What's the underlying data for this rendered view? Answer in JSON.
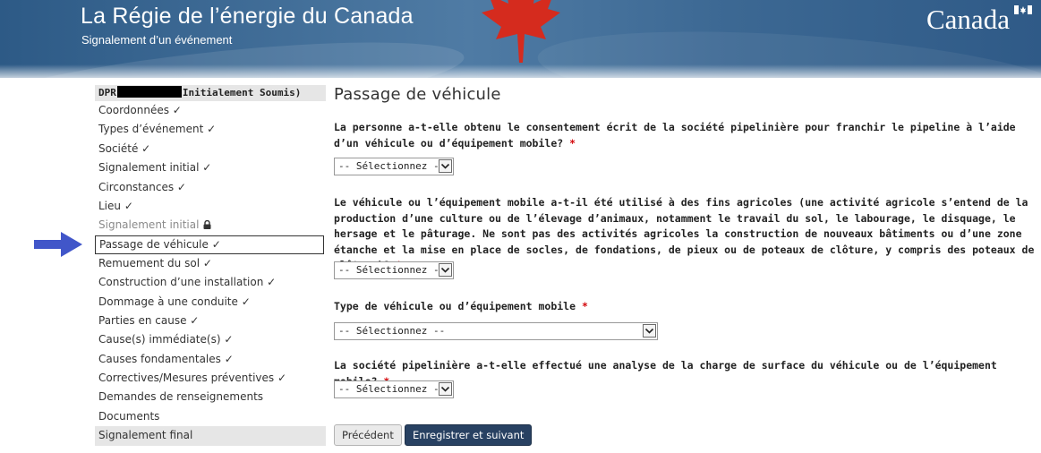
{
  "header": {
    "title": "La Régie de l’énergie du Canada",
    "subtitle": "Signalement d’un événement",
    "wordmark": "Canada",
    "icons": [
      "maple-leaf-icon",
      "canada-flag-icon"
    ]
  },
  "sidebar": {
    "header_prefix": "DPR",
    "header_suffix": "Initialement Soumis)",
    "items": [
      {
        "label": "Coordonnées ✓"
      },
      {
        "label": "Types d’événement ✓"
      },
      {
        "label": "Société ✓"
      },
      {
        "label": "Signalement initial ✓"
      },
      {
        "label": "Circonstances ✓"
      },
      {
        "label": "Lieu ✓"
      },
      {
        "label": "Signalement initial",
        "icon": "lock-icon",
        "state": "locked"
      },
      {
        "label": "Passage de véhicule ✓",
        "state": "active"
      },
      {
        "label": "Remuement du sol ✓"
      },
      {
        "label": "Construction d’une installation ✓"
      },
      {
        "label": "Dommage à une conduite ✓"
      },
      {
        "label": "Parties en cause ✓"
      },
      {
        "label": "Cause(s) immédiate(s) ✓"
      },
      {
        "label": "Causes fondamentales ✓"
      },
      {
        "label": "Correctives/Mesures préventives ✓"
      },
      {
        "label": "Demandes de renseignements"
      },
      {
        "label": "Documents"
      },
      {
        "label": "Signalement final"
      }
    ]
  },
  "main": {
    "title": "Passage de véhicule",
    "required_marker": "*",
    "questions": [
      {
        "text": "La personne a-t-elle obtenu le consentement écrit de la société pipelinière pour franchir le pipeline à l’aide d’un véhicule ou d’équipement mobile?",
        "select_value": "-- Sélectionnez --"
      },
      {
        "text": "Le véhicule ou l’équipement mobile a-t-il été utilisé à des fins agricoles (une activité agricole s’entend de la production d’une culture ou de l’élevage d’animaux, notamment le travail du sol, le labourage, le disquage, le hersage et le pâturage. Ne sont pas des activités agricoles la construction de nouveaux bâtiments ou d’une zone étanche et la mise en place de socles, de fondations, de pieux ou de poteaux de clôture, y compris des poteaux de clôture)?",
        "select_value": "-- Sélectionnez --"
      },
      {
        "text": "Type de véhicule ou d’équipement mobile",
        "select_value": "-- Sélectionnez --"
      },
      {
        "text": "La société pipelinière a-t-elle effectué une analyse de la charge de surface du véhicule ou de l’équipement mobile?",
        "select_value": "-- Sélectionnez --"
      }
    ],
    "buttons": {
      "previous": "Précédent",
      "save_next": "Enregistrer et suivant"
    }
  },
  "colors": {
    "banner": "#3f6a94",
    "primary_button": "#284162",
    "required": "#d3080c",
    "pointer_arrow": "#4156c9"
  }
}
